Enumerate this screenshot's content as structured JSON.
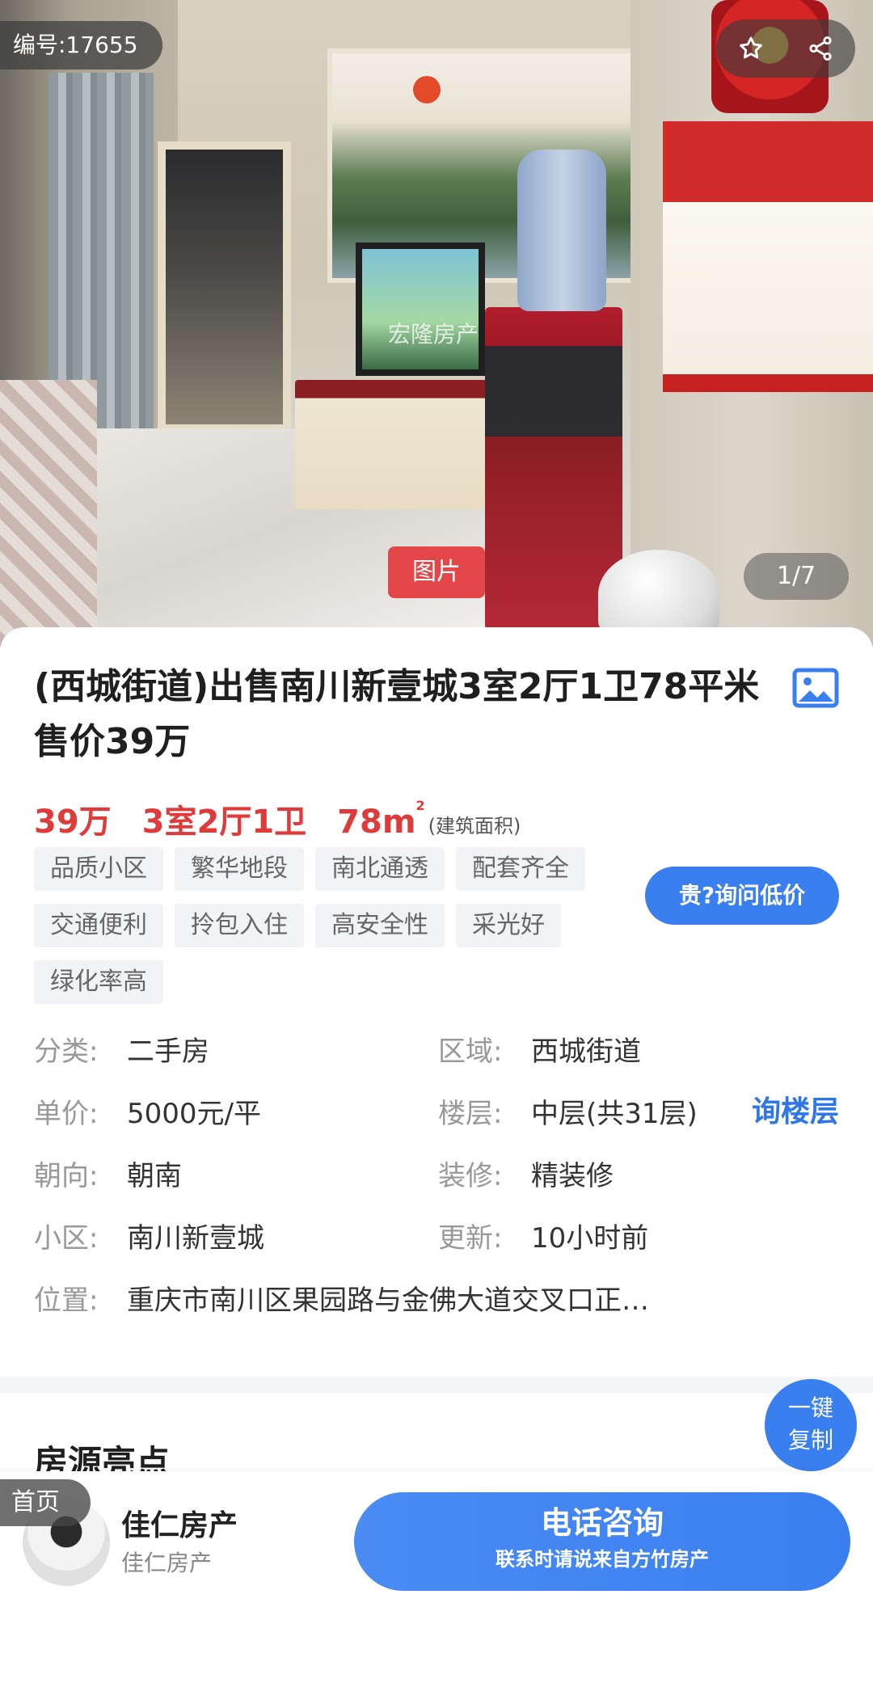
{
  "hero": {
    "listing_id": "编号:17655",
    "photo_button": "图片",
    "pager": "1/7",
    "watermark": "宏隆房产"
  },
  "listing": {
    "title": "(西城街道)出售南川新壹城3室2厅1卫78平米 售价39万",
    "price": "39万",
    "layout": "3室2厅1卫",
    "area": "78m",
    "area_sup": "2",
    "area_note": "(建筑面积)",
    "tags": [
      "品质小区",
      "繁华地段",
      "南北通透",
      "配套齐全",
      "交通便利",
      "拎包入住",
      "高安全性",
      "采光好",
      "绿化率高"
    ],
    "ask_price_button": "贵?询问低价"
  },
  "info": {
    "category_label": "分类:",
    "category_value": "二手房",
    "region_label": "区域:",
    "region_value": "西城街道",
    "unit_price_label": "单价:",
    "unit_price_value": "5000元/平",
    "floor_label": "楼层:",
    "floor_value": "中层(共31层)",
    "floor_link": "询楼层",
    "orientation_label": "朝向:",
    "orientation_value": "朝南",
    "decoration_label": "装修:",
    "decoration_value": "精装修",
    "community_label": "小区:",
    "community_value": "南川新壹城",
    "updated_label": "更新:",
    "updated_value": "10小时前",
    "location_label": "位置:",
    "location_value": "重庆市南川区果园路与金佛大道交叉口正…"
  },
  "section": {
    "highlights_title": "房源亮点",
    "copy_line1": "一键",
    "copy_line2": "复制"
  },
  "bottom": {
    "home_tab": "首页",
    "agent_name": "佳仁房产",
    "agent_org": "佳仁房产",
    "call_main": "电话咨询",
    "call_sub": "联系时请说来自方竹房产"
  },
  "colors": {
    "accent_blue": "#3a7ff0",
    "price_red": "#e03b3b",
    "photo_button_red": "#e4474a"
  }
}
